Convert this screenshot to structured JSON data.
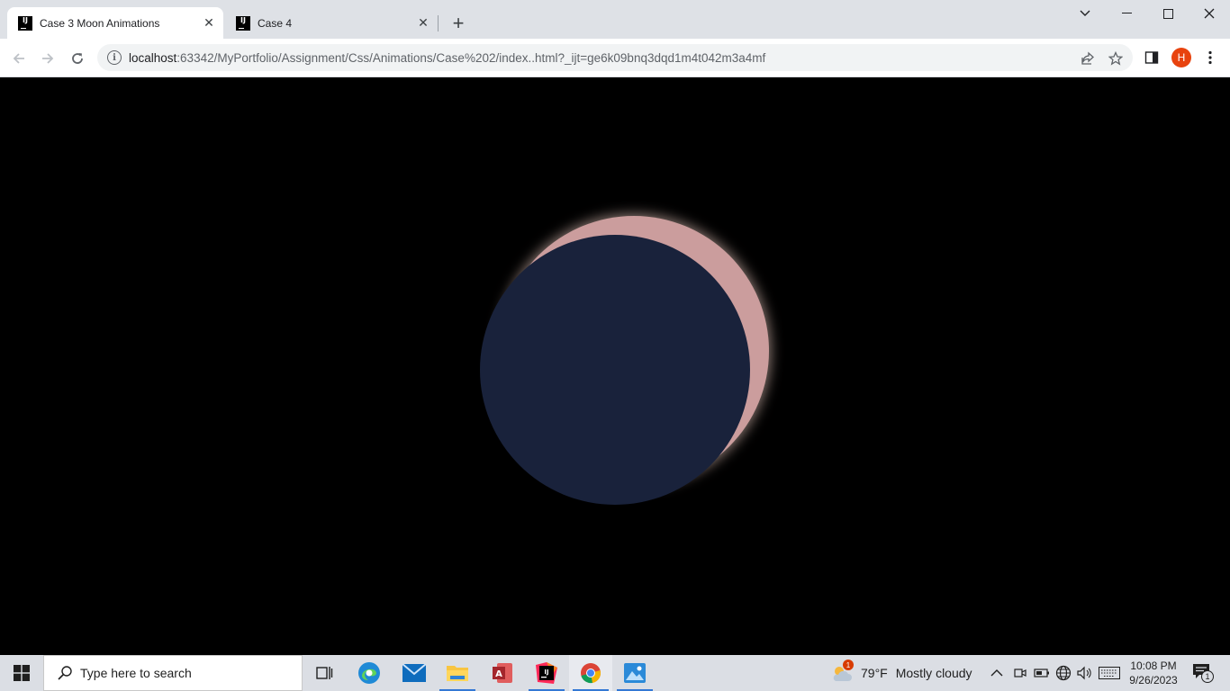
{
  "browser": {
    "tabs": [
      {
        "title": "Case 3 Moon Animations",
        "active": true
      },
      {
        "title": "Case 4",
        "active": false
      }
    ],
    "address": {
      "host": "localhost",
      "path": ":63342/MyPortfolio/Assignment/Css/Animations/Case%202/index..html?_ijt=ge6k09bnq3dqd1m4t042m3a4mf"
    },
    "profile_initial": "H",
    "window_controls": [
      "chevron-down-icon",
      "minimize-icon",
      "maximize-icon",
      "close-icon"
    ]
  },
  "page": {
    "background": "#000000",
    "moon_color": "#cb9d9d",
    "shadow_color": "#19223b"
  },
  "taskbar": {
    "search_placeholder": "Type here to search",
    "apps": [
      "task-view-icon",
      "edge-icon",
      "mail-icon",
      "file-explorer-icon",
      "access-icon",
      "intellij-icon",
      "chrome-icon",
      "photos-icon"
    ],
    "weather": {
      "temp": "79°F",
      "condition": "Mostly cloudy",
      "badge": "1"
    },
    "time": "10:08 PM",
    "date": "9/26/2023",
    "notifications": "1"
  }
}
